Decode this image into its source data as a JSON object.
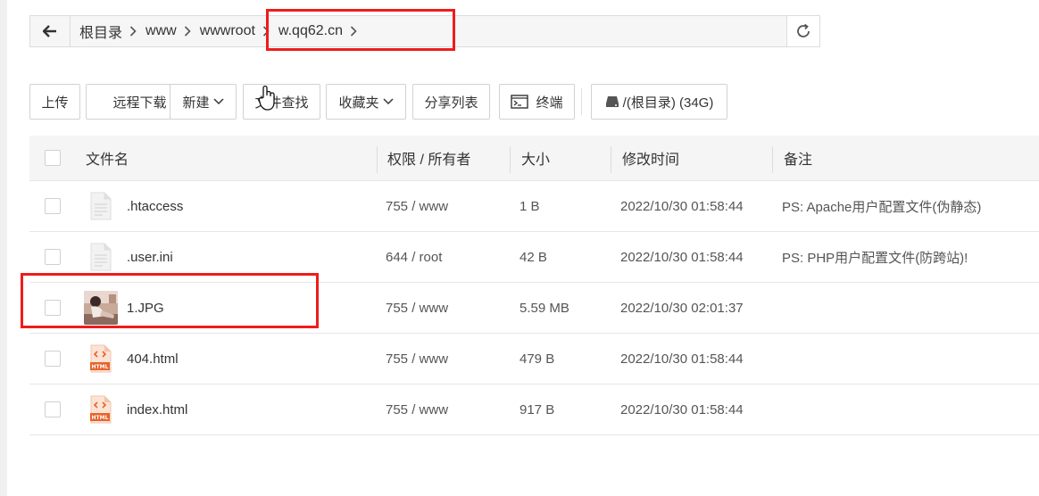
{
  "breadcrumb": {
    "items": [
      "根目录",
      "www",
      "wwwroot",
      "w.qq62.cn"
    ]
  },
  "toolbar": {
    "upload": "上传",
    "remote_download": "远程下载",
    "new": "新建",
    "file_search": "文件查找",
    "favorites": "收藏夹",
    "share_list": "分享列表",
    "terminal": "终端",
    "disk": "/(根目录) (34G)"
  },
  "table": {
    "headers": {
      "name": "文件名",
      "perm": "权限 / 所有者",
      "size": "大小",
      "mtime": "修改时间",
      "note": "备注"
    },
    "rows": [
      {
        "name": ".htaccess",
        "perm": "755 / www",
        "size": "1 B",
        "mtime": "2022/10/30 01:58:44",
        "note": "PS: Apache用户配置文件(伪静态)",
        "icon": "file-icon"
      },
      {
        "name": ".user.ini",
        "perm": "644 / root",
        "size": "42 B",
        "mtime": "2022/10/30 01:58:44",
        "note": "PS: PHP用户配置文件(防跨站)!",
        "icon": "file-icon"
      },
      {
        "name": "1.JPG",
        "perm": "755 / www",
        "size": "5.59 MB",
        "mtime": "2022/10/30 02:01:37",
        "note": "",
        "icon": "image-thumbnail"
      },
      {
        "name": "404.html",
        "perm": "755 / www",
        "size": "479 B",
        "mtime": "2022/10/30 01:58:44",
        "note": "",
        "icon": "html-file-icon"
      },
      {
        "name": "index.html",
        "perm": "755 / www",
        "size": "917 B",
        "mtime": "2022/10/30 01:58:44",
        "note": "",
        "icon": "html-file-icon"
      }
    ]
  },
  "colors": {
    "highlight": "#ee1c1c",
    "html_icon": "#e8632b",
    "header_bg": "#f5f5f5"
  }
}
